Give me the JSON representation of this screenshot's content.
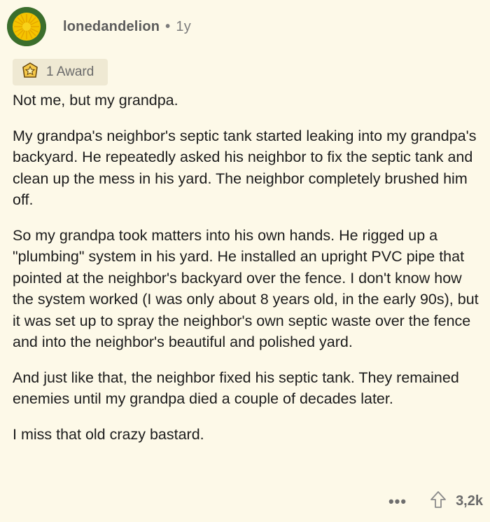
{
  "comment": {
    "username": "lonedandelion",
    "separator": "•",
    "age": "1y",
    "award_label": "1 Award",
    "paragraphs": [
      "Not me, but my grandpa.",
      "My grandpa's neighbor's septic tank started leaking into my grandpa's backyard. He repeatedly asked his neighbor to fix the septic tank and clean up the mess in his yard. The neighbor completely brushed him off.",
      "So my grandpa took matters into his own hands. He rigged up a \"plumbing\" system in his yard. He installed an upright PVC pipe that pointed at the neighbor's backyard over the fence. I don't know how the system worked (I was only about 8 years old, in the early 90s), but it was set up to spray the neighbor's own septic waste over the fence and into the neighbor's beautiful and polished yard.",
      "And just like that, the neighbor fixed his septic tank. They remained enemies until my grandpa died a couple of decades later.",
      "I miss that old crazy bastard."
    ],
    "more_label": "•••",
    "upvote_count": "3,2k"
  },
  "icons": {
    "avatar": "dandelion-avatar-icon",
    "award": "award-icon",
    "more": "more-options-icon",
    "upvote": "upvote-arrow-icon"
  },
  "colors": {
    "background": "#fdf9e8",
    "award_bg": "#efe9d3",
    "text": "#1c1c1c",
    "muted": "#6a6a6a"
  }
}
